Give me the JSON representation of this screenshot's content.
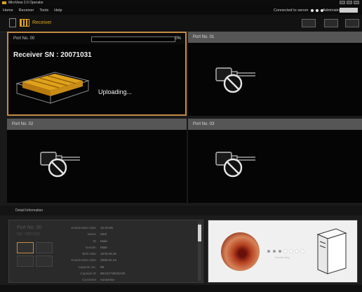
{
  "window": {
    "title": "MiroView 2.0 Operator"
  },
  "menu": {
    "items": [
      "Home",
      "Receiver",
      "Tools",
      "Help"
    ],
    "connection": "Connected to server",
    "user": "Administrator"
  },
  "toolbar": {
    "section_label": "Receiver"
  },
  "ports": [
    {
      "label": "Port No. 00",
      "progress_text": "0%",
      "progress_value": 0,
      "serial": "Receiver SN : 20071031",
      "status": "Uploading..."
    },
    {
      "label": "Port No. 01"
    },
    {
      "label": "Port No. 02"
    },
    {
      "label": "Port No. 03"
    }
  ],
  "detail": {
    "header": "Detail Information",
    "port_label": "Port No. 00",
    "port_id": "SN : 20071031",
    "fields": [
      {
        "k": "Examination date",
        "v": "12.03.05"
      },
      {
        "k": "Name",
        "v": "MeZ"
      },
      {
        "k": "ID",
        "v": "Male"
      },
      {
        "k": "Gender",
        "v": "Male"
      },
      {
        "k": "Birth date",
        "v": "1976.09.26"
      },
      {
        "k": "Examination date",
        "v": "2008.02.24"
      },
      {
        "k": "Capsule ver.",
        "v": "99"
      },
      {
        "k": "Capsule ID",
        "v": "BE10173E03A00"
      },
      {
        "k": "Comment",
        "v": "nonsense"
      }
    ],
    "transfer_label": "Transferring"
  },
  "colors": {
    "accent": "#e0a21b",
    "active_border": "#c58b44"
  },
  "icons": {
    "no_device": "unplugged-cable-icon",
    "receiver": "receiver-device-icon"
  }
}
